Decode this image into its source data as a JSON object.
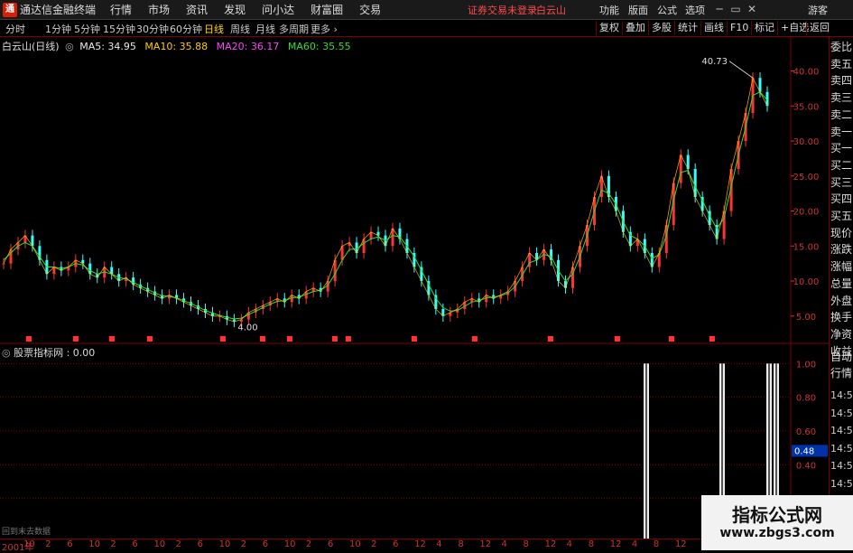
{
  "app": {
    "title": "通达信金融终端",
    "logo": "app-logo"
  },
  "menu": [
    "行情",
    "市场",
    "资讯",
    "发现",
    "问小达",
    "财富圈",
    "交易"
  ],
  "login_status": "证券交易未登录",
  "stock_tab": "白云山",
  "right_menu": [
    "功能",
    "版面",
    "公式",
    "选项"
  ],
  "guest": "游客",
  "toolbar": {
    "periods": [
      "分时",
      "1分钟",
      "5分钟",
      "15分钟",
      "30分钟",
      "60分钟",
      "日线",
      "周线",
      "月线",
      "多周期",
      "更多"
    ],
    "active_period": "日线",
    "right": [
      "复权",
      "叠加",
      "多股",
      "统计",
      "画线",
      "F10",
      "标记",
      "+自选",
      "返回"
    ]
  },
  "chart_info": {
    "name": "白云山(日线)",
    "ma": [
      {
        "label": "MA5: 34.95",
        "color": "#e8e8e8"
      },
      {
        "label": "MA10: 35.88",
        "color": "#ffcc00"
      },
      {
        "label": "MA20: 36.17",
        "color": "#ff44ff"
      },
      {
        "label": "MA60: 35.55",
        "color": "#33dd33"
      }
    ]
  },
  "indicator": {
    "label": "股票指标网 : 0.00"
  },
  "sidebar": [
    "委比",
    "卖五",
    "卖四",
    "卖三",
    "卖二",
    "卖一",
    "买一",
    "买二",
    "买三",
    "买四",
    "买五",
    "现价",
    "涨跌",
    "涨幅",
    "总量",
    "外盘",
    "换手",
    "净资",
    "收益",
    "自动",
    "行情",
    "14:50",
    "14:50",
    "14:50",
    "14:50",
    "14:50",
    "14:50",
    "14:50",
    "14:50",
    "14:50"
  ],
  "watermark": {
    "title": "指标公式网",
    "url": "www.zbgs3.com"
  },
  "no_data": "回到末去数据",
  "colors": {
    "up": "#ff3333",
    "down": "#33ffff",
    "grid": "#800000",
    "axis_text": "#cc3333",
    "current_value_bg": "#0033aa"
  },
  "chart_data": [
    {
      "type": "line",
      "title": "白云山(日线)",
      "ylim": [
        2,
        42
      ],
      "yticks": [
        "40.00",
        "35.00",
        "30.00",
        "25.00",
        "20.00",
        "15.00",
        "10.00",
        "5.00"
      ],
      "ytick_values": [
        40,
        35,
        30,
        25,
        20,
        15,
        10,
        5
      ],
      "price_series": [
        12.5,
        14.5,
        15.5,
        16.5,
        15,
        13,
        11,
        12,
        11.5,
        12,
        13,
        12.5,
        11,
        10.5,
        12,
        11,
        10,
        10.5,
        9.5,
        9,
        8.5,
        8,
        7.5,
        8,
        7.5,
        7,
        6.5,
        6,
        5.5,
        5,
        5,
        4.5,
        4.2,
        4.5,
        5.5,
        6,
        6.5,
        7,
        7.5,
        7,
        8,
        7.5,
        8.5,
        9,
        8.5,
        10,
        13,
        15,
        15.5,
        14,
        16,
        17,
        16.5,
        15,
        17.5,
        16,
        14,
        12,
        10,
        8,
        6,
        5,
        5.5,
        6,
        7,
        7.5,
        7,
        8,
        7.5,
        8,
        8.5,
        10,
        12,
        14,
        13,
        14.5,
        13,
        10,
        9,
        12,
        15,
        18,
        22,
        25,
        22,
        20,
        17,
        15,
        16,
        14,
        12,
        14,
        18,
        24,
        28,
        26,
        22,
        20,
        18,
        16,
        20,
        26,
        30,
        34,
        39,
        37,
        35
      ],
      "ma_series": [
        13,
        14,
        15,
        15.5,
        15,
        13.5,
        12,
        12,
        11.8,
        12,
        12.5,
        12.3,
        11.5,
        11,
        11.3,
        11,
        10.5,
        10.3,
        9.8,
        9.3,
        8.8,
        8.3,
        7.9,
        7.8,
        7.6,
        7.2,
        6.8,
        6.3,
        5.8,
        5.4,
        5.1,
        4.8,
        4.6,
        4.7,
        5.2,
        5.7,
        6.2,
        6.7,
        7.1,
        7.2,
        7.6,
        7.7,
        8.1,
        8.5,
        8.7,
        9.4,
        11,
        13,
        14.5,
        14.6,
        15.4,
        16,
        16.3,
        15.8,
        16.5,
        16.3,
        15,
        13.5,
        11.5,
        9.5,
        7.5,
        6.2,
        5.7,
        5.8,
        6.4,
        7,
        7.2,
        7.6,
        7.7,
        7.9,
        8.3,
        9.2,
        10.8,
        12.6,
        13,
        13.8,
        13.5,
        11.5,
        10,
        11,
        13.5,
        16.5,
        20,
        23,
        22.5,
        21,
        18.5,
        16.5,
        16,
        15,
        13.2,
        13.8,
        16.5,
        21.5,
        25.5,
        25.8,
        23.5,
        21.5,
        19.3,
        17.5,
        19,
        23.5,
        28,
        32,
        36.5,
        37,
        35.8
      ],
      "annotations": [
        "40.73",
        "4.00"
      ],
      "current_value": "0.48"
    },
    {
      "type": "bar",
      "title": "股票指标网",
      "yticks": [
        "1.00",
        "0.80",
        "0.60",
        "0.40",
        "0.20"
      ],
      "ytick_values": [
        1.0,
        0.8,
        0.6,
        0.4,
        0.2
      ],
      "bar_positions": [
        716,
        800,
        852,
        860
      ],
      "bar_values": [
        1.0,
        1.0,
        1.0,
        1.0
      ],
      "ylim": [
        0,
        1.05
      ]
    }
  ],
  "xaxis": [
    "2001年",
    "10",
    "2",
    "6",
    "10",
    "2",
    "6",
    "10",
    "2",
    "6",
    "10",
    "2",
    "6",
    "10",
    "2",
    "6",
    "10",
    "2",
    "6",
    "12",
    "4",
    "8",
    "12",
    "4",
    "8",
    "12",
    "4",
    "8",
    "12",
    "4",
    "8",
    "12"
  ]
}
